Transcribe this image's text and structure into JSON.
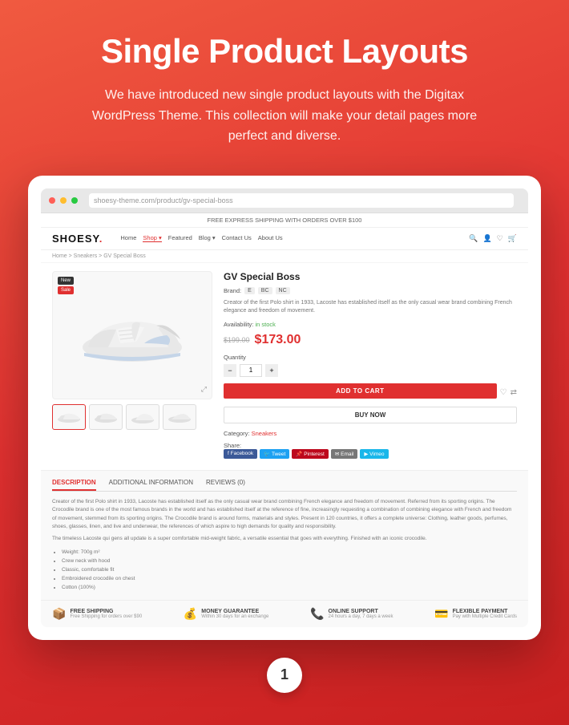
{
  "header": {
    "title": "Single Product Layouts",
    "subtitle": "We have introduced new single product layouts with the Digitax WordPress Theme. This collection will make your detail pages more perfect and diverse."
  },
  "browser": {
    "url": "shoesy-theme.com/product/gv-special-boss"
  },
  "shop": {
    "notice": "FREE EXPRESS SHIPPING WITH ORDERS OVER $100",
    "logo": "SHOESY.",
    "nav_links": [
      "Home",
      "Shop",
      "Featured",
      "Blog",
      "Contact Us",
      "About Us"
    ],
    "breadcrumb": "Home > Sneakers > GV Special Boss",
    "product": {
      "title": "GV Special Boss",
      "brand_label": "Brand:",
      "brand_badges": [
        "E",
        "BC",
        "NC"
      ],
      "description": "Creator of the first Polo shirt in 1933, Lacoste has established itself as the only casual wear brand combining French elegance and freedom of movement.",
      "availability_label": "Availability:",
      "availability_value": "in stock",
      "price_old": "$199.00",
      "price_new": "$173.00",
      "quantity_label": "Quantity",
      "qty_value": "1",
      "btn_add_cart": "ADD TO CART",
      "btn_buy_now": "BUY NOW",
      "category_label": "Category:",
      "category_value": "Sneakers",
      "share_label": "Share:",
      "social": [
        "Facebook",
        "Tweet",
        "Pinterest",
        "Email",
        "Vimeo"
      ],
      "badges": [
        "New",
        "Sale"
      ]
    },
    "tabs": {
      "items": [
        "DESCRIPTION",
        "ADDITIONAL INFORMATION",
        "REVIEWS (0)"
      ],
      "active": "DESCRIPTION",
      "content_paragraphs": [
        "Creator of the first Polo shirt in 1933, Lacoste has established itself as the only casual wear brand combining French elegance and freedom of movement. Referred from its sporting origins. The Crocodile brand is one of the most famous brands in the world and has established itself at the reference of fine, increasingly requesting a combination of combining elegance with French and freedom of movement, stemmed from its sporting origins. The Crocodile brand is around forms, materials and styles. Present in 120 countries, it offers a complete universe: Clothing, leather goods, perfumes, shoes, glasses, linen, and live and underwear, the references of which aspire to high demands for quality and responsibility.",
        "The timeless Lacoste qui gens all update is a super comfortable mid-weight fabric, a versatile essential that goes with everything. Finished with an iconic crocodile."
      ],
      "list_items": [
        "Weight: 700g m²",
        "Crew neck with hood",
        "Classic, comfortable fit",
        "Embroidered crocodile on chest",
        "Cotton (100%)"
      ]
    },
    "footer_features": [
      {
        "icon": "📦",
        "title": "FREE SHIPPING",
        "sub": "Free Shipping for orders over $90"
      },
      {
        "icon": "💰",
        "title": "MONEY GUARANTEE",
        "sub": "Within 30 days for an exchange"
      },
      {
        "icon": "📞",
        "title": "ONLINE SUPPORT",
        "sub": "24 hours a day, 7 days a week"
      },
      {
        "icon": "💳",
        "title": "FLEXIBLE PAYMENT",
        "sub": "Pay with Multiple Credit Cards"
      }
    ]
  },
  "page_number": "1"
}
